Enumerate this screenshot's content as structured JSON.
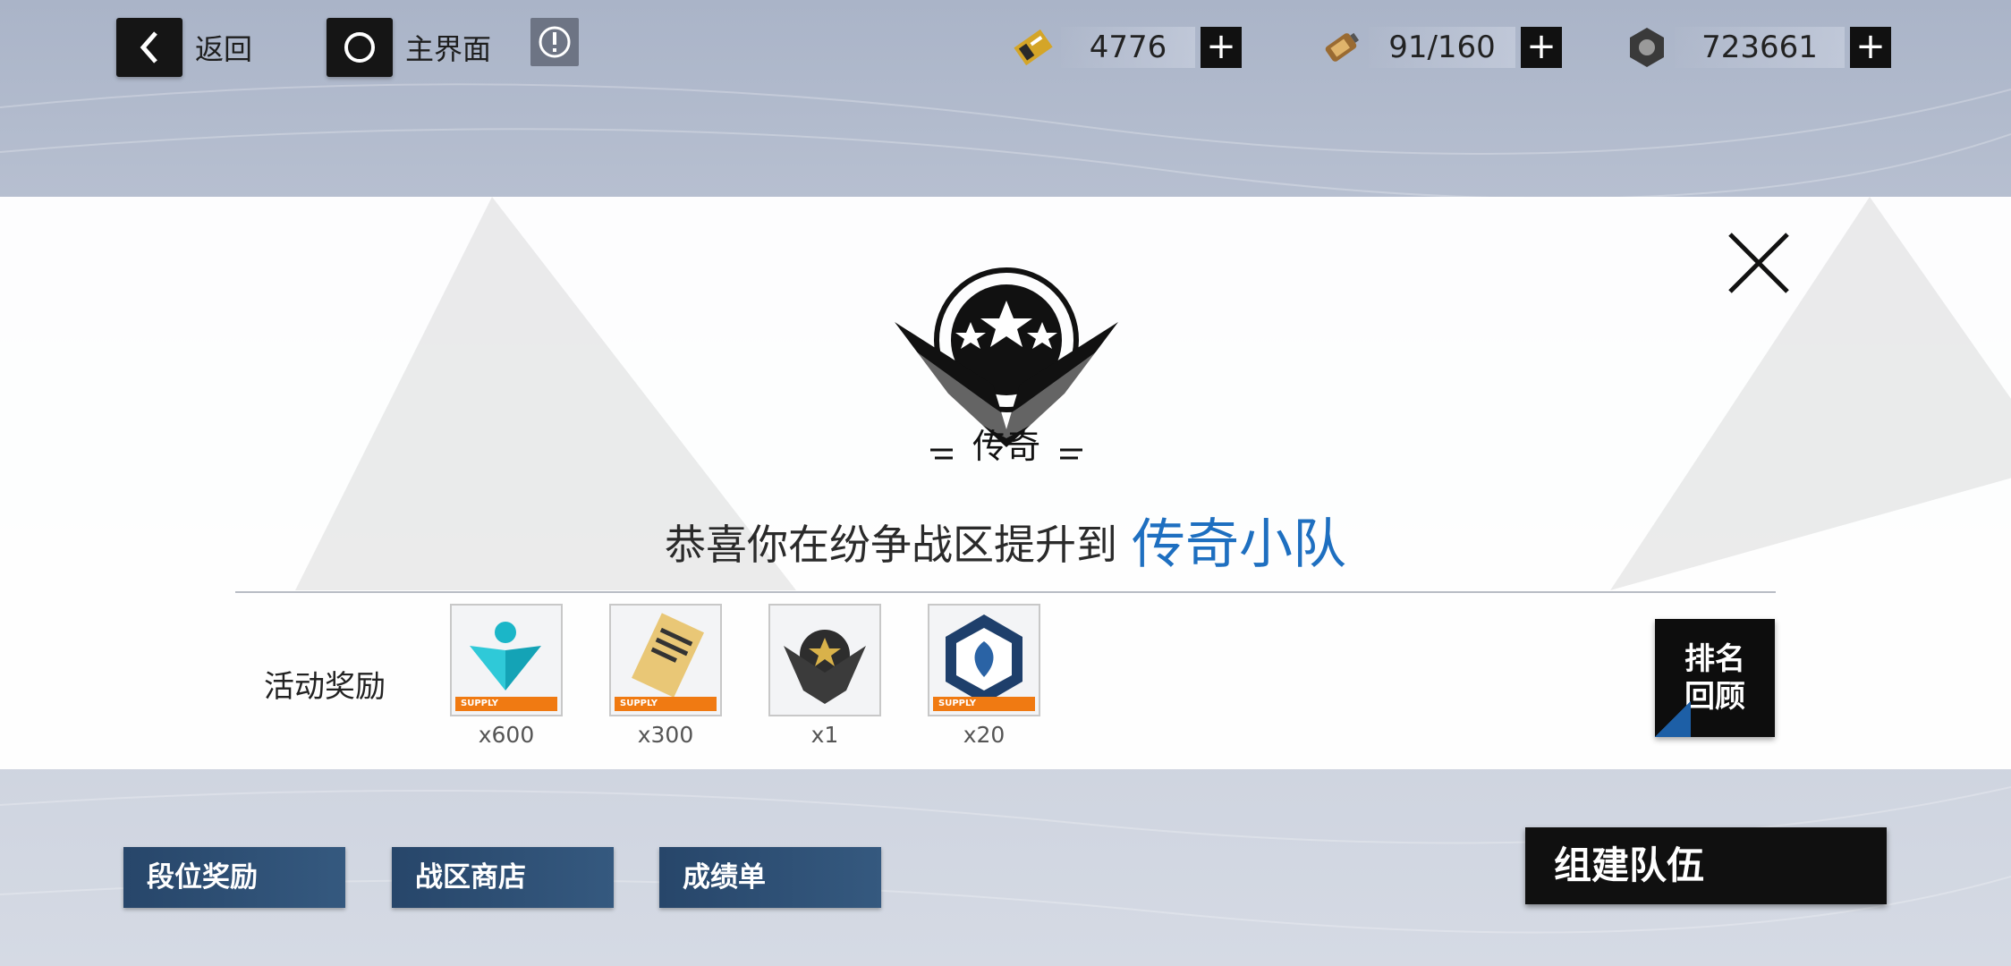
{
  "topbar": {
    "back_label": "返回",
    "home_label": "主界面",
    "resources": [
      {
        "icon": "ticket-icon",
        "value": "4776"
      },
      {
        "icon": "battery-icon",
        "value": "91/160"
      },
      {
        "icon": "gear-nut-icon",
        "value": "723661"
      }
    ]
  },
  "modal": {
    "emblem_text": "传奇",
    "congrats_text": "恭喜你在纷争战区提升到",
    "congrats_highlight": "传奇小队",
    "reward_label": "活动奖励",
    "rewards": [
      {
        "icon": "core-supply-icon",
        "count": "x600",
        "badge": "SUPPLY"
      },
      {
        "icon": "contract-supply-icon",
        "count": "x300",
        "badge": "SUPPLY"
      },
      {
        "icon": "legend-medal-icon",
        "count": "x1",
        "badge": ""
      },
      {
        "icon": "shield-supply-icon",
        "count": "x20",
        "badge": "SUPPLY"
      }
    ],
    "rank_review_line1": "排名",
    "rank_review_line2": "回顾"
  },
  "bottom": {
    "rank_rewards": "段位奖励",
    "zone_shop": "战区商店",
    "report_card": "成绩单",
    "form_team": "组建队伍"
  },
  "colors": {
    "highlight": "#1e6fc0",
    "bottom_button": "#2c4b70",
    "supply_strip": "#f07a12"
  }
}
